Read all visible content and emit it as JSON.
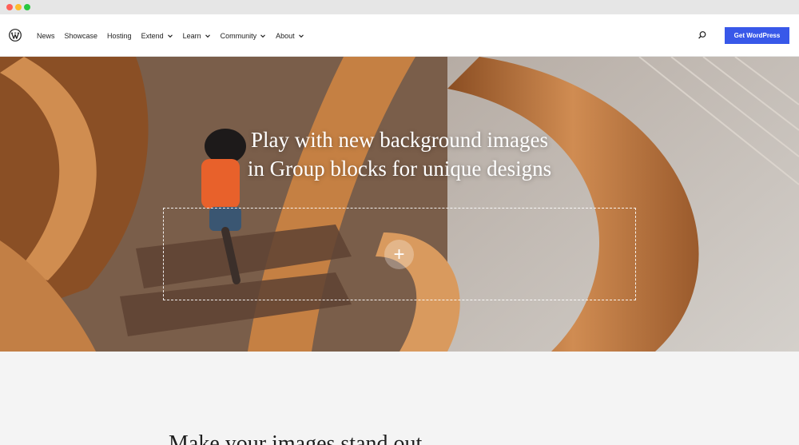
{
  "window": {
    "controls": [
      "close",
      "minimize",
      "maximize"
    ]
  },
  "header": {
    "logo_icon": "wordpress-logo-icon",
    "nav": [
      {
        "label": "News",
        "has_dropdown": false
      },
      {
        "label": "Showcase",
        "has_dropdown": false
      },
      {
        "label": "Hosting",
        "has_dropdown": false
      },
      {
        "label": "Extend",
        "has_dropdown": true
      },
      {
        "label": "Learn",
        "has_dropdown": true
      },
      {
        "label": "Community",
        "has_dropdown": true
      },
      {
        "label": "About",
        "has_dropdown": true
      }
    ],
    "search_icon": "search-icon",
    "cta_label": "Get WordPress",
    "cta_color": "#3858e9"
  },
  "hero": {
    "title_line1": "Play with new background images",
    "title_line2": "in Group blocks for unique designs",
    "add_block_symbol": "+",
    "add_block_icon": "plus-icon"
  },
  "section": {
    "heading": "Make your images stand out"
  }
}
